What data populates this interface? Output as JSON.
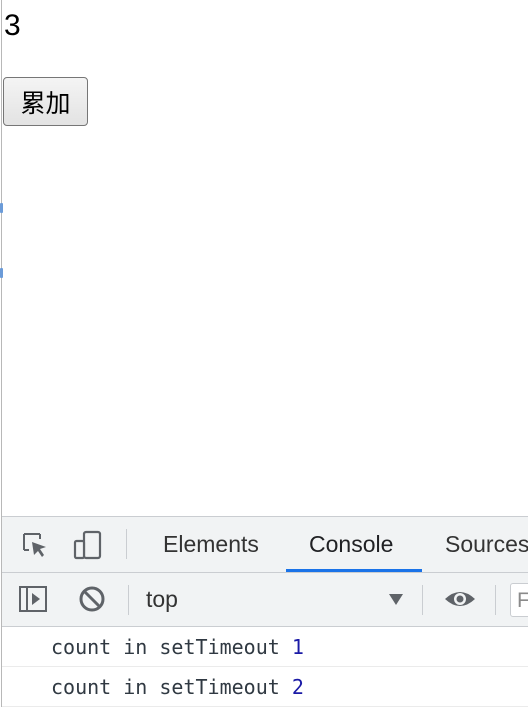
{
  "page": {
    "count": "3",
    "button_label": "累加"
  },
  "devtools": {
    "tabs": [
      {
        "label": "Elements",
        "active": false
      },
      {
        "label": "Console",
        "active": true
      },
      {
        "label": "Sources",
        "active": false
      }
    ],
    "toolbar": {
      "context": "top",
      "filter_placeholder": "F"
    },
    "console": [
      {
        "text": "count in setTimeout",
        "value": "1"
      },
      {
        "text": "count in setTimeout",
        "value": "2"
      }
    ],
    "icons": [
      "inspect-element-icon",
      "device-toolbar-icon",
      "sidebar-toggle-icon",
      "clear-console-icon",
      "dropdown-arrow-icon",
      "eye-icon"
    ],
    "colors": {
      "accent": "#1a73e8",
      "number": "#1a1aa6"
    }
  }
}
